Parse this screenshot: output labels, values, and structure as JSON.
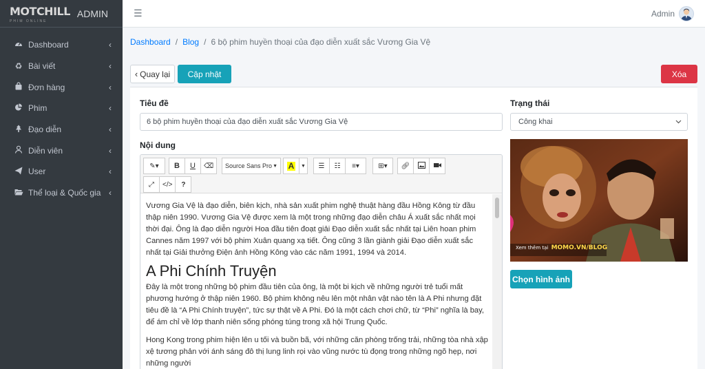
{
  "brand": {
    "logo_text": "MOTCHILL",
    "logo_sub": "PHIM ONLINE",
    "app_label": "ADMIN"
  },
  "sidebar": {
    "items": [
      {
        "label": "Dashboard",
        "icon": "tachometer-icon"
      },
      {
        "label": "Bài viết",
        "icon": "recycle-icon"
      },
      {
        "label": "Đơn hàng",
        "icon": "shopping-bag-icon"
      },
      {
        "label": "Phim",
        "icon": "pie-chart-icon"
      },
      {
        "label": "Đạo diễn",
        "icon": "tree-icon"
      },
      {
        "label": "Diễn viên",
        "icon": "user-icon"
      },
      {
        "label": "User",
        "icon": "paper-plane-icon"
      },
      {
        "label": "Thể loại & Quốc gia",
        "icon": "folder-open-icon"
      }
    ]
  },
  "topbar": {
    "user_name": "Admin"
  },
  "breadcrumb": {
    "home": "Dashboard",
    "section": "Blog",
    "current": "6 bộ phim huyền thoại của đạo diễn xuất sắc Vương Gia Vệ",
    "separator": "/"
  },
  "actions": {
    "back": "Quay lại",
    "update": "Cập nhật",
    "delete": "Xóa"
  },
  "form": {
    "title_label": "Tiêu đề",
    "title_value": "6 bộ phim huyền thoại của đạo diễn xuất sắc Vương Gia Vệ",
    "content_label": "Nội dung",
    "status_label": "Trạng thái",
    "status_value": "Công khai",
    "choose_image": "Chọn hình ảnh",
    "image_caption_prefix": "Xem thêm tại",
    "image_caption_link": "MOMO.VN/BLOG"
  },
  "editor": {
    "font_name": "Source Sans Pro",
    "paragraphs": [
      "Vương Gia Vệ là đạo diễn, biên kịch, nhà sản xuất phim nghệ thuật hàng đầu Hồng Kông từ đầu thập niên 1990. Vương Gia Vệ được xem là một trong những đạo diễn châu Á xuất sắc nhất mọi thời đại. Ông là đạo diễn người Hoa đầu tiên đoạt giải Đạo diễn xuất sắc nhất tại Liên hoan phim Cannes năm 1997 với bộ phim Xuân quang xạ tiết. Ông cũng 3 lần giành giải Đạo diễn xuất sắc nhất tại Giải thưởng Điện ảnh Hồng Kông vào các năm 1991, 1994 và 2014.",
      "Đây là một trong những bộ phim đầu tiên của ông, là một bi kịch về những người trẻ tuổi mất phương hướng ở thập niên 1960. Bộ phim không nêu lên một nhân vật nào tên là A Phi nhưng đặt tiêu đề là “A Phi Chính truyện”, tức sự thật về A Phi. Đó là một cách chơi chữ, từ “Phi” nghĩa là bay, để ám chỉ về lớp thanh niên sống phóng túng trong xã hội Trung Quốc.",
      "Hong Kong trong phim hiện lên u tối và buồn bã, với những căn phòng trống trải, những tòa nhà xập xệ tương phản với ánh sáng đô thị lung linh rọi vào vũng nước tù đọng trong những ngõ hẹp, nơi những người"
    ],
    "heading": "A Phi Chính Truyện"
  }
}
